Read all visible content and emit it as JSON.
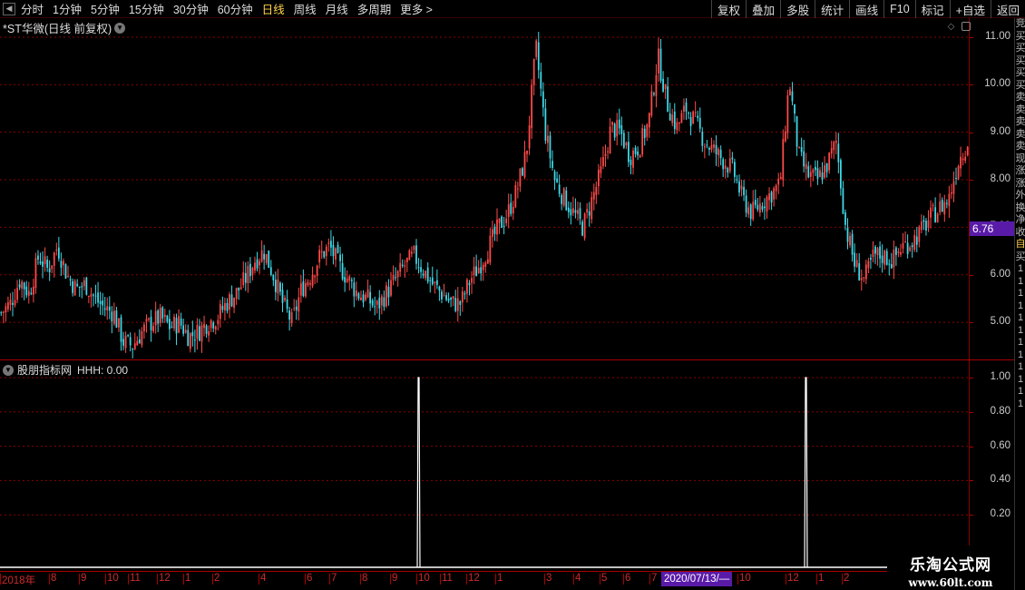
{
  "toolbar": {
    "periods": [
      "分时",
      "1分钟",
      "5分钟",
      "15分钟",
      "30分钟",
      "60分钟",
      "日线",
      "周线",
      "月线",
      "多周期",
      "更多 >"
    ],
    "active_period": "日线",
    "right_buttons": [
      "复权",
      "叠加",
      "多股",
      "统计",
      "画线",
      "F10",
      "标记",
      "+自选",
      "返回"
    ]
  },
  "main_chart": {
    "title": "*ST华微(日线 前复权)",
    "current_price_tag": "6.76",
    "y_labels": [
      "11.00",
      "10.00",
      "9.00",
      "8.00",
      "7.00",
      "6.00",
      "5.00"
    ]
  },
  "indicator": {
    "title": "股朋指标网",
    "value_text": "HHH: 0.00",
    "y_labels": [
      "1.00",
      "0.80",
      "0.60",
      "0.40",
      "0.20"
    ]
  },
  "time_axis": {
    "labels": [
      "2018年",
      "8",
      "9",
      "10",
      "11",
      "12",
      "1",
      "2",
      "4",
      "6",
      "7",
      "8",
      "9",
      "10",
      "11",
      "12",
      "1",
      "3",
      "4",
      "5",
      "6",
      "7",
      "10",
      "12",
      "1",
      "2"
    ],
    "cursor_label": "2020/07/13/—"
  },
  "side_strip": {
    "chars": [
      "竞",
      "买",
      "买",
      "买",
      "买",
      "买",
      "卖",
      "卖",
      "卖",
      "卖",
      "卖",
      "现",
      "涨",
      "涨",
      "外",
      "换",
      "净",
      "收",
      "自",
      "买",
      "1",
      "1",
      "1",
      "1",
      "1",
      "1",
      "1",
      "1",
      "1",
      "1",
      "1",
      "1"
    ]
  },
  "watermark": {
    "brand": "乐淘公式网",
    "url": "www.60lt.com"
  },
  "colors": {
    "up": "#ff4a4a",
    "down": "#3fd9e8",
    "grid": "#8a0000",
    "accent": "#5a1aa8",
    "active": "#ffd24a"
  },
  "chart_data": {
    "type": "candlestick",
    "price_axis": {
      "min": 4.2,
      "max": 11.4,
      "ticks": [
        5,
        6,
        7,
        8,
        9,
        10,
        11
      ]
    },
    "close_series": [
      5.2,
      5.4,
      5.9,
      5.6,
      6.4,
      6.1,
      6.6,
      6.0,
      5.7,
      5.8,
      5.5,
      5.3,
      5.2,
      4.6,
      4.5,
      4.8,
      5.0,
      5.1,
      4.9,
      5.0,
      4.7,
      4.8,
      5.0,
      5.1,
      5.4,
      5.6,
      5.9,
      6.3,
      6.5,
      6.0,
      5.4,
      5.0,
      5.7,
      6.0,
      6.4,
      6.6,
      6.2,
      5.9,
      5.6,
      5.5,
      5.3,
      5.6,
      5.9,
      6.2,
      6.4,
      6.1,
      5.8,
      5.6,
      5.4,
      5.4,
      5.9,
      6.2,
      6.6,
      7.0,
      7.3,
      7.8,
      8.6,
      10.8,
      9.0,
      8.0,
      7.6,
      7.3,
      7.0,
      7.6,
      8.2,
      9.1,
      9.0,
      8.5,
      8.7,
      9.2,
      10.6,
      9.6,
      9.1,
      9.5,
      9.2,
      8.8,
      8.6,
      8.4,
      8.2,
      7.6,
      7.3,
      7.5,
      7.7,
      7.9,
      10.1,
      8.5,
      8.1,
      8.0,
      8.3,
      8.8,
      7.0,
      6.2,
      5.9,
      6.4,
      6.4,
      6.3,
      6.6,
      6.7,
      6.9,
      7.2,
      7.4,
      7.6,
      8.4,
      8.8
    ],
    "indicator_series": {
      "name": "HHH",
      "signal_points": [
        {
          "x_label": "10",
          "value": 1.0
        },
        {
          "x_label": "12",
          "value": 1.0
        }
      ],
      "baseline": 0.0
    }
  }
}
